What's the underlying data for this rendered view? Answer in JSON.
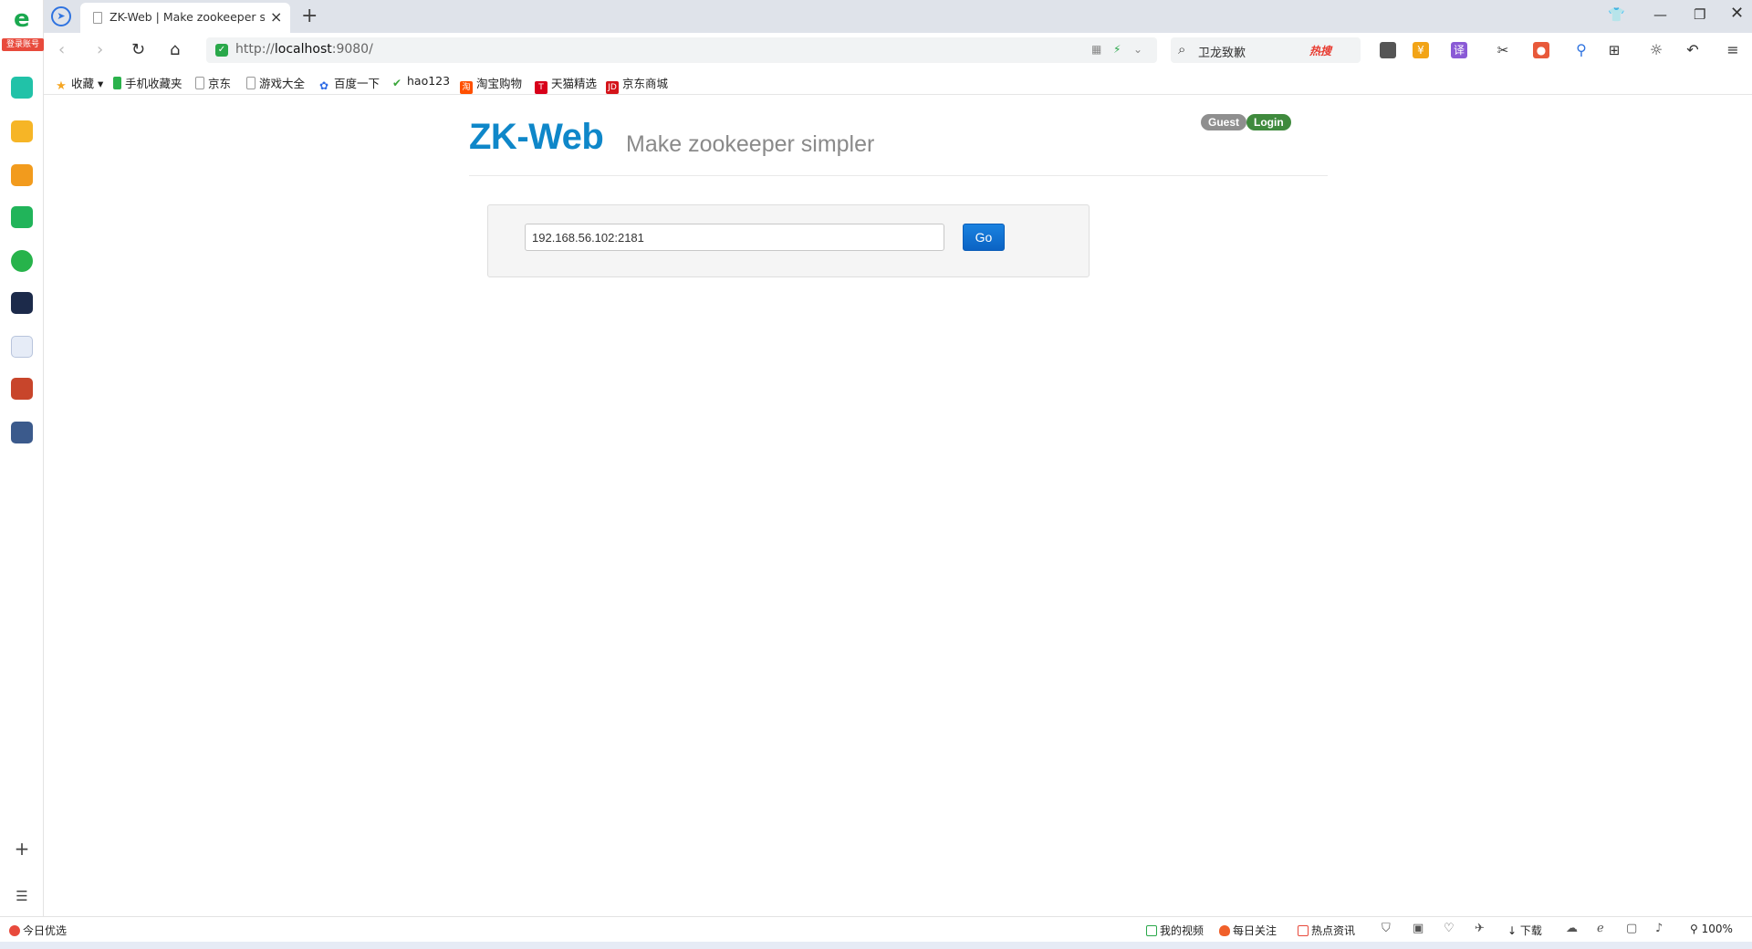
{
  "browser": {
    "login_badge": "登录账号",
    "tab_title": "ZK-Web | Make zookeeper s",
    "url_prefix": "http://",
    "url_host": "localhost",
    "url_suffix": ":9080/",
    "search_query": "卫龙致歉",
    "search_hot": "热搜",
    "zoom": "100%"
  },
  "bookmarks": [
    {
      "label": "收藏",
      "icon": "star-icon",
      "color": "#f5a623"
    },
    {
      "label": "手机收藏夹",
      "icon": "phone-icon",
      "color": "#2bb24c"
    },
    {
      "label": "京东",
      "icon": "doc-icon",
      "color": "#999999"
    },
    {
      "label": "游戏大全",
      "icon": "doc-icon",
      "color": "#999999"
    },
    {
      "label": "百度一下",
      "icon": "baidu-icon",
      "color": "#2e6be6"
    },
    {
      "label": "hao123",
      "icon": "hao123-icon",
      "color": "#3aa63a"
    },
    {
      "label": "淘宝购物",
      "icon": "taobao-icon",
      "color": "#ff5000"
    },
    {
      "label": "天猫精选",
      "icon": "tmall-icon",
      "color": "#d8001a"
    },
    {
      "label": "京东商城",
      "icon": "jd-icon",
      "color": "#d4141a"
    }
  ],
  "page": {
    "brand": "ZK-Web",
    "tagline": "Make zookeeper simpler",
    "guest_label": "Guest",
    "login_label": "Login",
    "host_value": "192.168.56.102:2181",
    "go_label": "Go"
  },
  "statusbar": {
    "left_label": "今日优选",
    "my_video": "我的视频",
    "daily_follow": "每日关注",
    "hot_news": "热点资讯",
    "download": "下载"
  },
  "colors": {
    "brand_blue": "#0f87c9",
    "go_button": "#0b63c4",
    "login_green": "#3f8a3d",
    "guest_gray": "#8f8f8f"
  }
}
